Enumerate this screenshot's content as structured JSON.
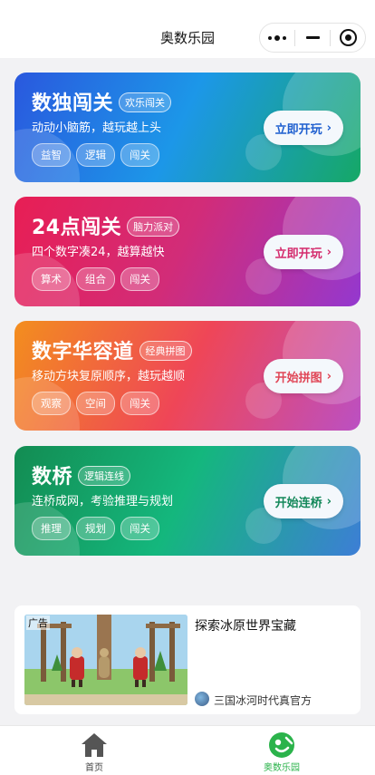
{
  "navbar": {
    "title": "奥数乐园",
    "more_icon": "more-dots-icon",
    "minimize_icon": "minimize-icon",
    "close_icon": "target-close-icon"
  },
  "games": [
    {
      "title": "数独闯关",
      "badge": "欢乐闯关",
      "desc": "动动小脑筋，越玩越上头",
      "tags": [
        "益智",
        "逻辑",
        "闯关"
      ],
      "button": "立即开玩",
      "button_arrow": "›",
      "colors": [
        "#2a58de",
        "#1c97e8",
        "#16a866"
      ]
    },
    {
      "title": "24点闯关",
      "badge": "脑力派对",
      "desc": "四个数字凑24，越算越快",
      "tags": [
        "算术",
        "组合",
        "闯关"
      ],
      "button": "立即开玩",
      "button_arrow": "›",
      "colors": [
        "#e81e54",
        "#d22c78",
        "#9438cf"
      ]
    },
    {
      "title": "数字华容道",
      "badge": "经典拼图",
      "desc": "移动方块复原顺序，越玩越顺",
      "tags": [
        "观察",
        "空间",
        "闯关"
      ],
      "button": "开始拼图",
      "button_arrow": "›",
      "colors": [
        "#f38e1e",
        "#ef4657",
        "#bb50c3"
      ]
    },
    {
      "title": "数桥",
      "badge": "逻辑连线",
      "desc": "连桥成网，考验推理与规划",
      "tags": [
        "推理",
        "规划",
        "闯关"
      ],
      "button": "开始连桥",
      "button_arrow": "›",
      "colors": [
        "#138c52",
        "#14b77d",
        "#3d7ed6"
      ]
    }
  ],
  "ad": {
    "label": "广告",
    "title": "探索冰原世界宝藏",
    "sponsor": "三国冰河时代真官方"
  },
  "tabbar": {
    "items": [
      {
        "label": "首页",
        "icon": "home-icon",
        "active": false,
        "color": "#444444"
      },
      {
        "label": "奥数乐园",
        "icon": "game-icon",
        "active": true,
        "color": "#2bb34b"
      }
    ]
  }
}
